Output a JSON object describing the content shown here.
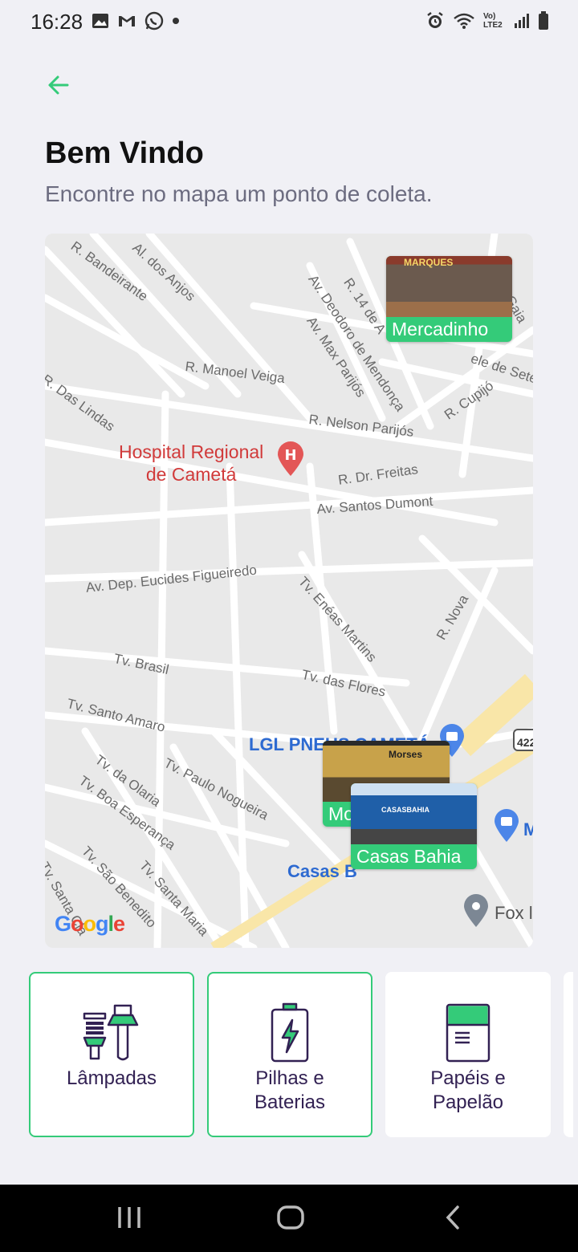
{
  "status_bar": {
    "time": "16:28",
    "left_icons": [
      "gallery-icon",
      "gmail-icon",
      "whatsapp-icon",
      "dot-icon"
    ],
    "right_icons": [
      "alarm-icon",
      "wifi-icon",
      "volte-icon",
      "signal-icon",
      "battery-icon"
    ],
    "network_label": "Vo) LTE2"
  },
  "header": {
    "title": "Bem Vindo",
    "subtitle": "Encontre no mapa um ponto de coleta."
  },
  "map": {
    "streets": [
      "R. Bandeirante",
      "Al. dos Anjos",
      "Av. Deodoro de Mendonça",
      "Av. Max Parijós",
      "R. 14 de A",
      "R. Manoel Veiga",
      "R. Das Lindas",
      "R. Nelson Parijós",
      "R. Cupijó",
      "ele de Seter",
      "R. Dr. Freitas",
      "Av. Santos Dumont",
      "Av. Dep. Eucides Figueiredo",
      "Tv. Enéas Martins",
      "R. Nova",
      "Tv. Brasil",
      "Tv. das Flores",
      "Tv. Santo Amaro",
      "Tv. Paulo Nogueira",
      "Tv. da Olaria",
      "Tv. Boa Esperança",
      "Tv. São Benedito",
      "Tv. Santa Cla",
      "Tv. Santa Maria",
      "Gaia",
      "422"
    ],
    "pois": {
      "hospital": "Hospital Regional\nde Cametá",
      "lgl": "LGL PNEUS CAMETÁ",
      "casas": "Casas B",
      "fox": "Fox l",
      "m": "M"
    },
    "markers": [
      {
        "name": "Mercadinho",
        "sign": "MARQUES"
      },
      {
        "name": "Mo",
        "sign": "Morses"
      },
      {
        "name": "Casas Bahia",
        "sign": "CASASBAHIA"
      }
    ],
    "google_logo": [
      "G",
      "o",
      "o",
      "g",
      "l",
      "e"
    ],
    "colors": {
      "road": "#ffffff",
      "background": "#e9e9e9",
      "highway": "#f9e6a8",
      "marker": "#34cb79"
    }
  },
  "items": [
    {
      "label": "Lâmpadas",
      "icon": "lamps-icon",
      "selected": true
    },
    {
      "label": "Pilhas e\nBaterias",
      "icon": "battery-icon",
      "selected": true
    },
    {
      "label": "Papéis e\nPapelão",
      "icon": "paper-icon",
      "selected": false
    }
  ],
  "nav_bar": {
    "buttons": [
      "recent-apps-icon",
      "home-icon",
      "back-nav-icon"
    ]
  },
  "colors": {
    "accent": "#34cb79",
    "text_primary": "#322153",
    "subtitle": "#6c6c80"
  }
}
